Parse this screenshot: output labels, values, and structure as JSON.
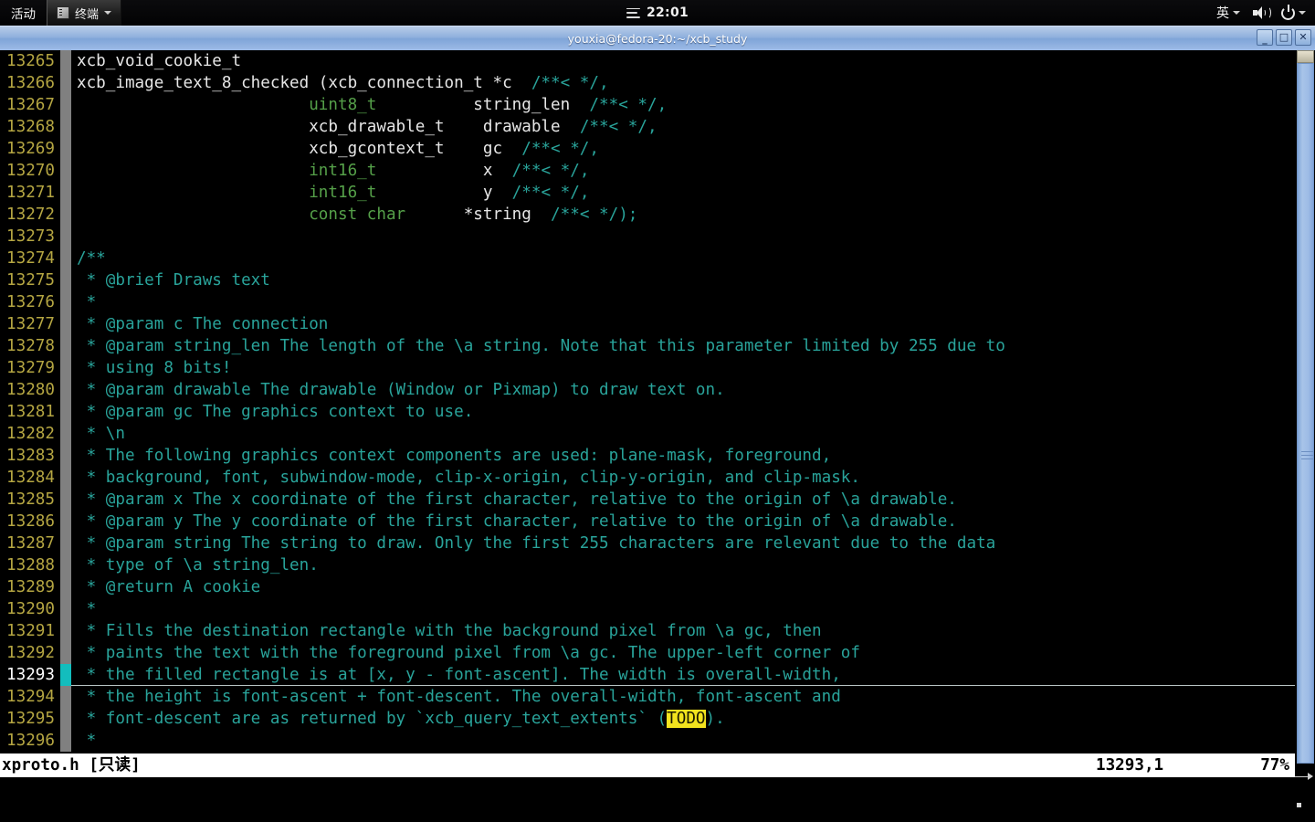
{
  "top_panel": {
    "activities_label": "活动",
    "app_name": "终端",
    "clock": "22:01",
    "ime_label": "英"
  },
  "window": {
    "title": "youxia@fedora-20:~/xcb_study",
    "minimize_glyph": "_",
    "maximize_glyph": "□",
    "close_glyph": "✕"
  },
  "editor": {
    "lines": [
      {
        "num": "13265",
        "segments": [
          {
            "t": "xcb_void_cookie_t",
            "c": ""
          }
        ]
      },
      {
        "num": "13266",
        "segments": [
          {
            "t": "xcb_image_text_8_checked (xcb_connection_t *c  ",
            "c": ""
          },
          {
            "t": "/**< */,",
            "c": "cmt"
          }
        ]
      },
      {
        "num": "13267",
        "segments": [
          {
            "t": "                        ",
            "c": ""
          },
          {
            "t": "uint8_t",
            "c": "typ"
          },
          {
            "t": "          string_len  ",
            "c": ""
          },
          {
            "t": "/**< */,",
            "c": "cmt"
          }
        ]
      },
      {
        "num": "13268",
        "segments": [
          {
            "t": "                        xcb_drawable_t    drawable  ",
            "c": ""
          },
          {
            "t": "/**< */,",
            "c": "cmt"
          }
        ]
      },
      {
        "num": "13269",
        "segments": [
          {
            "t": "                        xcb_gcontext_t    gc  ",
            "c": ""
          },
          {
            "t": "/**< */,",
            "c": "cmt"
          }
        ]
      },
      {
        "num": "13270",
        "segments": [
          {
            "t": "                        ",
            "c": ""
          },
          {
            "t": "int16_t",
            "c": "typ"
          },
          {
            "t": "           x  ",
            "c": ""
          },
          {
            "t": "/**< */,",
            "c": "cmt"
          }
        ]
      },
      {
        "num": "13271",
        "segments": [
          {
            "t": "                        ",
            "c": ""
          },
          {
            "t": "int16_t",
            "c": "typ"
          },
          {
            "t": "           y  ",
            "c": ""
          },
          {
            "t": "/**< */,",
            "c": "cmt"
          }
        ]
      },
      {
        "num": "13272",
        "segments": [
          {
            "t": "                        ",
            "c": ""
          },
          {
            "t": "const char",
            "c": "typ"
          },
          {
            "t": "      *string  ",
            "c": ""
          },
          {
            "t": "/**< */);",
            "c": "cmt"
          }
        ]
      },
      {
        "num": "13273",
        "segments": [
          {
            "t": "",
            "c": ""
          }
        ]
      },
      {
        "num": "13274",
        "segments": [
          {
            "t": "/**",
            "c": "cmt"
          }
        ]
      },
      {
        "num": "13275",
        "segments": [
          {
            "t": " * @brief Draws text",
            "c": "cmt"
          }
        ]
      },
      {
        "num": "13276",
        "segments": [
          {
            "t": " *",
            "c": "cmt"
          }
        ]
      },
      {
        "num": "13277",
        "segments": [
          {
            "t": " * @param c The connection",
            "c": "cmt"
          }
        ]
      },
      {
        "num": "13278",
        "segments": [
          {
            "t": " * @param string_len The length of the \\a string. Note that this parameter limited by 255 due to",
            "c": "cmt"
          }
        ]
      },
      {
        "num": "13279",
        "segments": [
          {
            "t": " * using 8 bits!",
            "c": "cmt"
          }
        ]
      },
      {
        "num": "13280",
        "segments": [
          {
            "t": " * @param drawable The drawable (Window or Pixmap) to draw text on.",
            "c": "cmt"
          }
        ]
      },
      {
        "num": "13281",
        "segments": [
          {
            "t": " * @param gc The graphics context to use.",
            "c": "cmt"
          }
        ]
      },
      {
        "num": "13282",
        "segments": [
          {
            "t": " * \\n",
            "c": "cmt"
          }
        ]
      },
      {
        "num": "13283",
        "segments": [
          {
            "t": " * The following graphics context components are used: plane-mask, foreground,",
            "c": "cmt"
          }
        ]
      },
      {
        "num": "13284",
        "segments": [
          {
            "t": " * background, font, subwindow-mode, clip-x-origin, clip-y-origin, and clip-mask.",
            "c": "cmt"
          }
        ]
      },
      {
        "num": "13285",
        "segments": [
          {
            "t": " * @param x The x coordinate of the first character, relative to the origin of \\a drawable.",
            "c": "cmt"
          }
        ]
      },
      {
        "num": "13286",
        "segments": [
          {
            "t": " * @param y The y coordinate of the first character, relative to the origin of \\a drawable.",
            "c": "cmt"
          }
        ]
      },
      {
        "num": "13287",
        "segments": [
          {
            "t": " * @param string The string to draw. Only the first 255 characters are relevant due to the data",
            "c": "cmt"
          }
        ]
      },
      {
        "num": "13288",
        "segments": [
          {
            "t": " * type of \\a string_len.",
            "c": "cmt"
          }
        ]
      },
      {
        "num": "13289",
        "segments": [
          {
            "t": " * @return A cookie",
            "c": "cmt"
          }
        ]
      },
      {
        "num": "13290",
        "segments": [
          {
            "t": " *",
            "c": "cmt"
          }
        ]
      },
      {
        "num": "13291",
        "segments": [
          {
            "t": " * Fills the destination rectangle with the background pixel from \\a gc, then",
            "c": "cmt"
          }
        ]
      },
      {
        "num": "13292",
        "segments": [
          {
            "t": " * paints the text with the foreground pixel from \\a gc. The upper-left corner of",
            "c": "cmt"
          }
        ]
      },
      {
        "num": "13293",
        "cursorline": true,
        "segments": [
          {
            "t": " * the filled rectangle is at [x, y - font-ascent]. The width is overall-width,",
            "c": "cmt"
          }
        ]
      },
      {
        "num": "13294",
        "segments": [
          {
            "t": " * the height is font-ascent + font-descent. The overall-width, font-ascent and",
            "c": "cmt"
          }
        ]
      },
      {
        "num": "13295",
        "segments": [
          {
            "t": " * font-descent are as returned by `xcb_query_text_extents` (",
            "c": "cmt"
          },
          {
            "t": "TODO",
            "c": "todo"
          },
          {
            "t": ").",
            "c": "cmt"
          }
        ]
      },
      {
        "num": "13296",
        "segments": [
          {
            "t": " *",
            "c": "cmt"
          }
        ]
      }
    ]
  },
  "status_line": {
    "file": "xproto.h [只读]",
    "position": "13293,1",
    "percent": "77%"
  },
  "colors": {
    "line_number": "#b5a642",
    "comment": "#29a39a",
    "type": "#55a049",
    "todo_highlight": "#f2e31e",
    "cursor": "#13bdbd",
    "fold_column": "#808080",
    "titlebar": "#8fb0dd"
  }
}
